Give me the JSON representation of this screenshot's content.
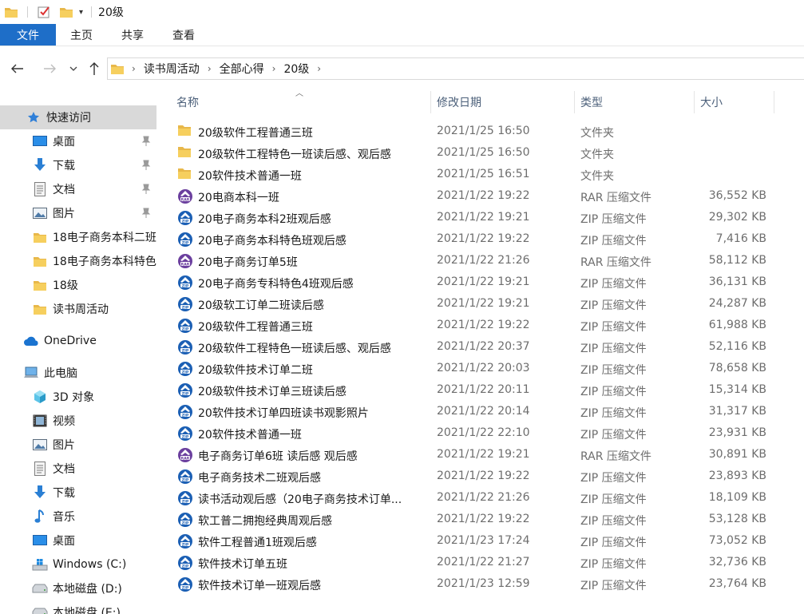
{
  "window": {
    "title": "20级"
  },
  "ribbon": {
    "tabs": [
      "文件",
      "主页",
      "共享",
      "查看"
    ]
  },
  "address": {
    "crumbs": [
      "读书周活动",
      "全部心得",
      "20级"
    ]
  },
  "columns": {
    "name": "名称",
    "date": "修改日期",
    "type": "类型",
    "size": "大小"
  },
  "nav": {
    "quick_access": {
      "label": "快速访问",
      "icon": "star-icon"
    },
    "pinned": [
      {
        "label": "桌面",
        "icon": "desktop-icon"
      },
      {
        "label": "下载",
        "icon": "download-icon"
      },
      {
        "label": "文档",
        "icon": "documents-icon"
      },
      {
        "label": "图片",
        "icon": "pictures-icon"
      }
    ],
    "recent_folders": [
      "18电子商务本科二班",
      "18电子商务本科特色",
      "18级",
      "读书周活动"
    ],
    "onedrive": {
      "label": "OneDrive",
      "icon": "cloud-icon"
    },
    "this_pc": {
      "label": "此电脑",
      "icon": "computer-icon"
    },
    "pc_items": [
      {
        "label": "3D 对象",
        "icon": "3d-objects-icon"
      },
      {
        "label": "视频",
        "icon": "video-icon"
      },
      {
        "label": "图片",
        "icon": "pictures-icon"
      },
      {
        "label": "文档",
        "icon": "documents-icon"
      },
      {
        "label": "下载",
        "icon": "download-icon"
      },
      {
        "label": "音乐",
        "icon": "music-icon"
      },
      {
        "label": "桌面",
        "icon": "desktop-icon"
      },
      {
        "label": "Windows (C:)",
        "icon": "windows-drive-icon"
      },
      {
        "label": "本地磁盘 (D:)",
        "icon": "drive-icon"
      },
      {
        "label": "本地磁盘 (E:)",
        "icon": "drive-icon"
      }
    ]
  },
  "files": [
    {
      "name": "20级软件工程普通三班",
      "date": "2021/1/25 16:50",
      "type": "文件夹",
      "size": "",
      "icon": "folder"
    },
    {
      "name": "20级软件工程特色一班读后感、观后感",
      "date": "2021/1/25 16:50",
      "type": "文件夹",
      "size": "",
      "icon": "folder"
    },
    {
      "name": "20软件技术普通一班",
      "date": "2021/1/25 16:51",
      "type": "文件夹",
      "size": "",
      "icon": "folder"
    },
    {
      "name": "20电商本科一班",
      "date": "2021/1/22 19:22",
      "type": "RAR 压缩文件",
      "size": "36,552 KB",
      "icon": "rar"
    },
    {
      "name": "20电子商务本科2班观后感",
      "date": "2021/1/22 19:21",
      "type": "ZIP 压缩文件",
      "size": "29,302 KB",
      "icon": "zip"
    },
    {
      "name": "20电子商务本科特色班观后感",
      "date": "2021/1/22 19:22",
      "type": "ZIP 压缩文件",
      "size": "7,416 KB",
      "icon": "zip"
    },
    {
      "name": "20电子商务订单5班",
      "date": "2021/1/22 21:26",
      "type": "RAR 压缩文件",
      "size": "58,112 KB",
      "icon": "rar"
    },
    {
      "name": "20电子商务专科特色4班观后感",
      "date": "2021/1/22 19:21",
      "type": "ZIP 压缩文件",
      "size": "36,131 KB",
      "icon": "zip"
    },
    {
      "name": "20级软工订单二班读后感",
      "date": "2021/1/22 19:21",
      "type": "ZIP 压缩文件",
      "size": "24,287 KB",
      "icon": "zip"
    },
    {
      "name": "20级软件工程普通三班",
      "date": "2021/1/22 19:22",
      "type": "ZIP 压缩文件",
      "size": "61,988 KB",
      "icon": "zip"
    },
    {
      "name": "20级软件工程特色一班读后感、观后感",
      "date": "2021/1/22 20:37",
      "type": "ZIP 压缩文件",
      "size": "52,116 KB",
      "icon": "zip"
    },
    {
      "name": "20级软件技术订单二班",
      "date": "2021/1/22 20:03",
      "type": "ZIP 压缩文件",
      "size": "78,658 KB",
      "icon": "zip"
    },
    {
      "name": "20级软件技术订单三班读后感",
      "date": "2021/1/22 20:11",
      "type": "ZIP 压缩文件",
      "size": "15,314 KB",
      "icon": "zip"
    },
    {
      "name": "20软件技术订单四班读书观影照片",
      "date": "2021/1/22 20:14",
      "type": "ZIP 压缩文件",
      "size": "31,317 KB",
      "icon": "zip"
    },
    {
      "name": "20软件技术普通一班",
      "date": "2021/1/22 22:10",
      "type": "ZIP 压缩文件",
      "size": "23,931 KB",
      "icon": "zip"
    },
    {
      "name": "电子商务订单6班  读后感 观后感",
      "date": "2021/1/22 19:21",
      "type": "RAR 压缩文件",
      "size": "30,891 KB",
      "icon": "rar"
    },
    {
      "name": "电子商务技术二班观后感",
      "date": "2021/1/22 19:22",
      "type": "ZIP 压缩文件",
      "size": "23,893 KB",
      "icon": "zip"
    },
    {
      "name": "读书活动观后感（20电子商务技术订单...",
      "date": "2021/1/22 21:26",
      "type": "ZIP 压缩文件",
      "size": "18,109 KB",
      "icon": "zip"
    },
    {
      "name": "软工普二拥抱经典周观后感",
      "date": "2021/1/22 19:22",
      "type": "ZIP 压缩文件",
      "size": "53,128 KB",
      "icon": "zip"
    },
    {
      "name": "软件工程普通1班观后感",
      "date": "2021/1/23 17:24",
      "type": "ZIP 压缩文件",
      "size": "73,052 KB",
      "icon": "zip"
    },
    {
      "name": "软件技术订单五班",
      "date": "2021/1/22 21:27",
      "type": "ZIP 压缩文件",
      "size": "32,736 KB",
      "icon": "zip"
    },
    {
      "name": "软件技术订单一班观后感",
      "date": "2021/1/23 12:59",
      "type": "ZIP 压缩文件",
      "size": "23,764 KB",
      "icon": "zip"
    }
  ]
}
